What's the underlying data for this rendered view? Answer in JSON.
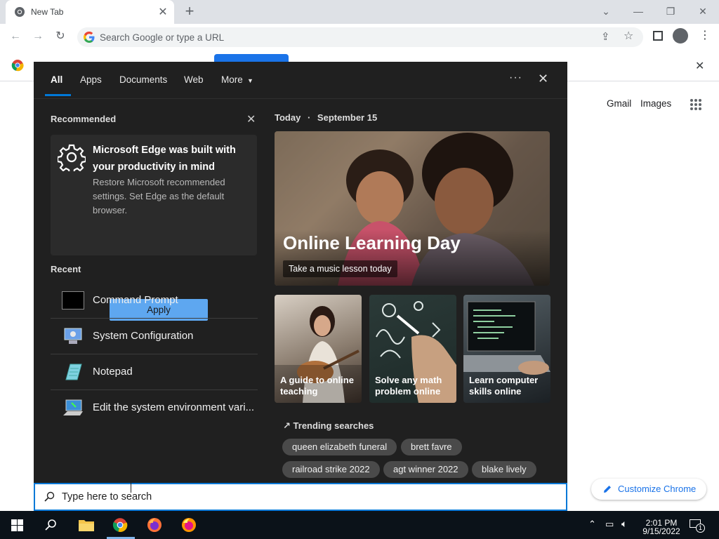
{
  "browser": {
    "tab_title": "New Tab",
    "omnibox_placeholder": "Search Google or type a URL"
  },
  "ntp": {
    "gmail": "Gmail",
    "images": "Images",
    "customize": "Customize Chrome"
  },
  "panel": {
    "tabs": [
      "All",
      "Apps",
      "Documents",
      "Web",
      "More"
    ],
    "recommended_header": "Recommended",
    "rec_title": "Microsoft Edge was built with your productivity in mind",
    "rec_body": "Restore Microsoft recommended settings. Set Edge as the default browser.",
    "apply_label": "Apply",
    "recent_header": "Recent",
    "recent": [
      {
        "label": "Command Prompt",
        "icon": "command-prompt-icon"
      },
      {
        "label": "System Configuration",
        "icon": "system-configuration-icon"
      },
      {
        "label": "Notepad",
        "icon": "notepad-icon"
      },
      {
        "label": "Edit the system environment vari...",
        "icon": "system-properties-icon"
      }
    ],
    "today_label": "Today",
    "today_date": "September 15",
    "hero_title": "Online Learning Day",
    "hero_subtitle": "Take a music lesson today",
    "cards": [
      "A guide to online teaching",
      "Solve any math problem online",
      "Learn computer skills online"
    ],
    "trending_header": "Trending searches",
    "trending": [
      "queen elizabeth funeral",
      "brett favre",
      "railroad strike 2022",
      "agt winner 2022",
      "blake lively"
    ],
    "search_placeholder": "Type here to search"
  },
  "taskbar": {
    "time": "2:01 PM",
    "date": "9/15/2022",
    "notification_count": "1"
  },
  "colors": {
    "accent": "#0078d7",
    "apply_button": "#5ea7f0",
    "panel_bg": "#202020",
    "chrome_link": "#1a73e8"
  }
}
